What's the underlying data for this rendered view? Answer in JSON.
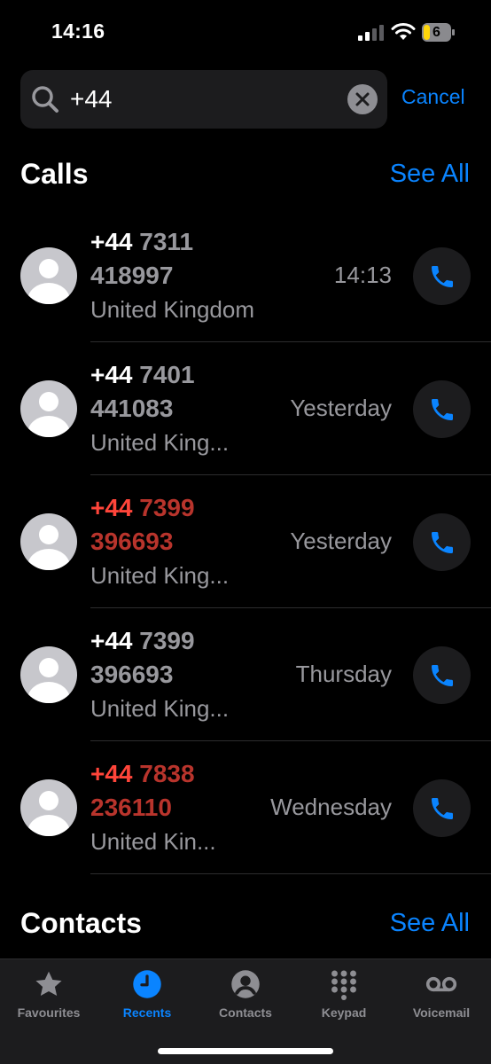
{
  "status": {
    "time": "14:16",
    "battery": "6"
  },
  "search": {
    "value": "+44",
    "cancel_label": "Cancel"
  },
  "calls_section": {
    "title": "Calls",
    "see_all": "See All"
  },
  "calls": [
    {
      "prefix": "+44",
      "rest1": "7311",
      "rest2": "418997",
      "country": "United Kingdom",
      "time": "14:13",
      "missed": false
    },
    {
      "prefix": "+44",
      "rest1": "7401",
      "rest2": "441083",
      "country": "United King...",
      "time": "Yesterday",
      "missed": false
    },
    {
      "prefix": "+44",
      "rest1": "7399",
      "rest2": "396693",
      "country": "United King...",
      "time": "Yesterday",
      "missed": true
    },
    {
      "prefix": "+44",
      "rest1": "7399",
      "rest2": "396693",
      "country": "United King...",
      "time": "Thursday",
      "missed": false
    },
    {
      "prefix": "+44",
      "rest1": "7838",
      "rest2": "236110",
      "country": "United Kin...",
      "time": "Wednesday",
      "missed": true
    }
  ],
  "contacts_section": {
    "title": "Contacts",
    "see_all": "See All"
  },
  "tabs": [
    {
      "label": "Favourites",
      "icon": "star-icon",
      "active": false
    },
    {
      "label": "Recents",
      "icon": "clock-icon",
      "active": true
    },
    {
      "label": "Contacts",
      "icon": "person-circle-icon",
      "active": false
    },
    {
      "label": "Keypad",
      "icon": "keypad-icon",
      "active": false
    },
    {
      "label": "Voicemail",
      "icon": "voicemail-icon",
      "active": false
    }
  ],
  "colors": {
    "accent": "#0a84ff",
    "missed": "#ff453a",
    "background": "#000000"
  }
}
